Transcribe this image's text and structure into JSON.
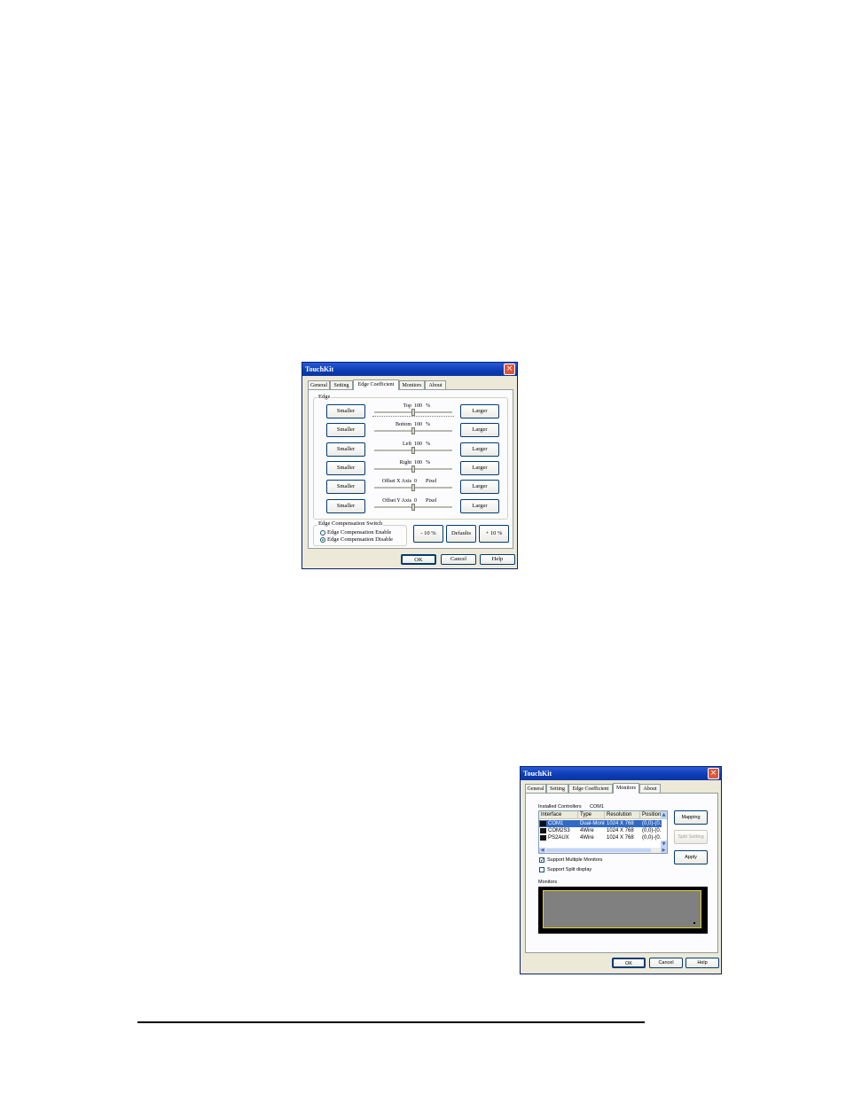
{
  "dialog1": {
    "title": "TouchKit",
    "close": "×",
    "tabs": [
      "General",
      "Setting",
      "Edge Coefficient",
      "Monitors",
      "About"
    ],
    "edge_group": "Edge",
    "rows": [
      {
        "label": "Top",
        "value": "100",
        "unit": "%",
        "level": 0.5
      },
      {
        "label": "Bottom",
        "value": "100",
        "unit": "%",
        "level": 0.5
      },
      {
        "label": "Left",
        "value": "100",
        "unit": "%",
        "level": 0.5
      },
      {
        "label": "Right",
        "value": "100",
        "unit": "%",
        "level": 0.5
      },
      {
        "label": "Offset X Axis",
        "value": "0",
        "unit": "Pixel",
        "level": 0.5
      },
      {
        "label": "Offset Y Axis",
        "value": "0",
        "unit": "Pixel",
        "level": 0.5
      }
    ],
    "smaller": "Smaller",
    "larger": "Larger",
    "switch_group": "Edge Compensation Switch",
    "enable": "Edge Compensation Enable",
    "disable": "Edge Compensation Disable",
    "minus": "- 10 %",
    "defaults": "Defaults",
    "plus": "+ 10 %",
    "ok": "OK",
    "cancel": "Cancel",
    "help": "Help"
  },
  "dialog2": {
    "title": "TouchKit",
    "close": "×",
    "tabs": [
      "General",
      "Setting",
      "Edge Coefficient",
      "Monitors",
      "About"
    ],
    "installed_label": "Installed Controllers",
    "installed_value": "COM1",
    "columns": [
      "Interface",
      "Type",
      "Resolution",
      "Position"
    ],
    "rows": [
      {
        "interface": "COM1",
        "type": "Dual-Monit...",
        "resolution": "1024 X 768",
        "position": "(0,0)-(0..."
      },
      {
        "interface": "COM2S3",
        "type": "4Wire",
        "resolution": "1024 X 768",
        "position": "(0,0)-(0..."
      },
      {
        "interface": "PS2AUX",
        "type": "4Wire",
        "resolution": "1024 X 768",
        "position": "(0,0)-(0..."
      }
    ],
    "mapping": "Mapping",
    "split_setting": "Split Setting",
    "apply": "Apply",
    "support_multiple": "Support Multiple Monitors",
    "support_split": "Support Split display",
    "check_mark": "✓",
    "monitors_label": "Monitors",
    "ok": "OK",
    "cancel": "Cancel",
    "help": "Help"
  }
}
